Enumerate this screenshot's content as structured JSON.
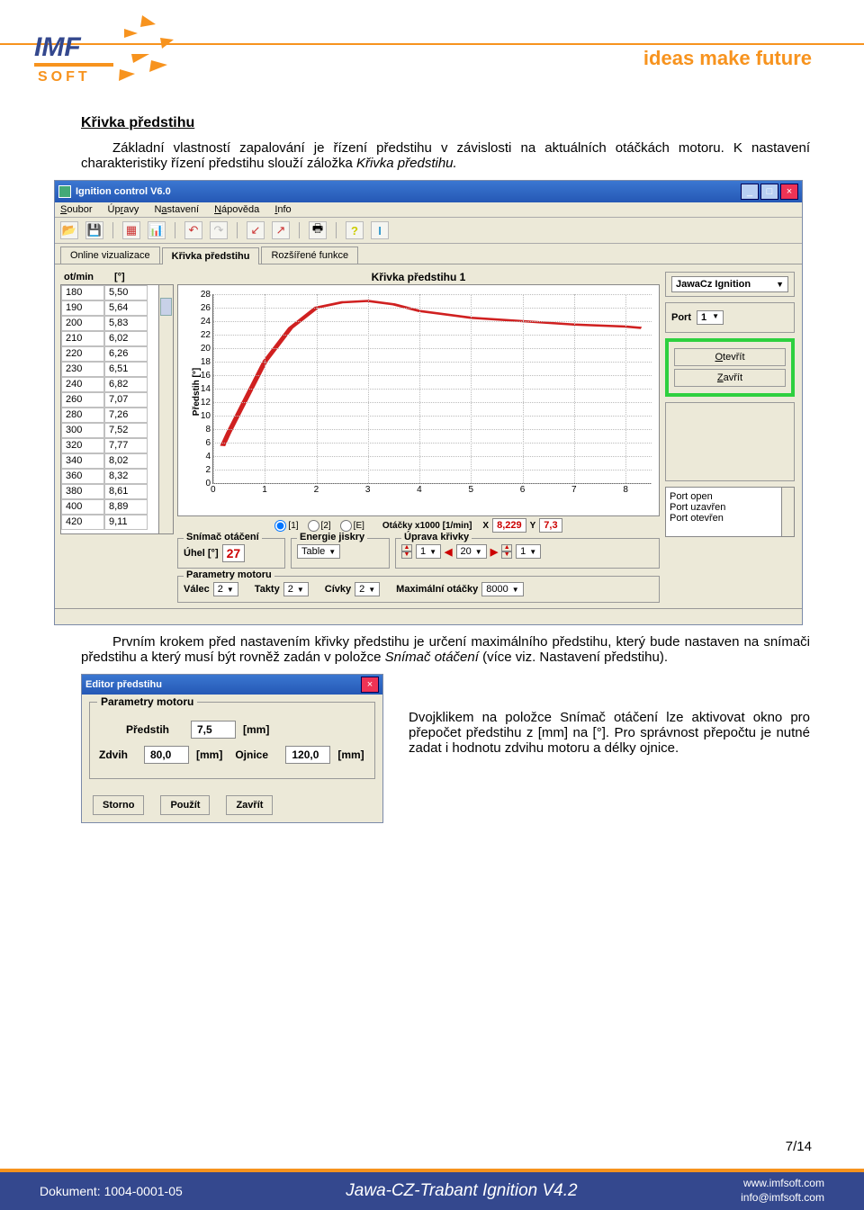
{
  "tagline": "ideas make future",
  "heading": "Křivka předstihu",
  "para1a": "Základní vlastností zapalování je řízení předstihu v závislosti na aktuálních otáčkách motoru. K nastavení charakteristiky řízení předstihu slouží záložka ",
  "para1b": "Křivka předstihu.",
  "para2a": "Prvním krokem před nastavením křivky předstihu je určení maximálního předstihu, který bude nastaven na snímači předstihu a který musí být rovněž zadán v položce ",
  "para2b": "Snímač otáčení",
  "para2c": " (více viz. Nastavení předstihu).",
  "para3": "Dvojklikem na položce Snímač otáčení lze aktivovat okno pro přepočet předstihu z [mm] na [°]. Pro správnost přepočtu je nutné zadat i hodnotu zdvihu motoru a délky ojnice.",
  "app": {
    "title": "Ignition control V6.0",
    "menu": [
      "Soubor",
      "Úpravy",
      "Nastavení",
      "Nápověda",
      "Info"
    ],
    "tabs": [
      "Online vizualizace",
      "Křivka předstihu",
      "Rozšířené funkce"
    ],
    "col1": "ot/min",
    "col2": "[°]",
    "tableRows": [
      [
        "180",
        "5,50"
      ],
      [
        "190",
        "5,64"
      ],
      [
        "200",
        "5,83"
      ],
      [
        "210",
        "6,02"
      ],
      [
        "220",
        "6,26"
      ],
      [
        "230",
        "6,51"
      ],
      [
        "240",
        "6,82"
      ],
      [
        "260",
        "7,07"
      ],
      [
        "280",
        "7,26"
      ],
      [
        "300",
        "7,52"
      ],
      [
        "320",
        "7,77"
      ],
      [
        "340",
        "8,02"
      ],
      [
        "360",
        "8,32"
      ],
      [
        "380",
        "8,61"
      ],
      [
        "400",
        "8,89"
      ],
      [
        "420",
        "9,11"
      ]
    ],
    "chartTitle": "Křivka předstihu 1",
    "yAxisLabel": "Předstih [°]",
    "yticks": [
      "28",
      "26",
      "24",
      "22",
      "20",
      "18",
      "16",
      "14",
      "12",
      "10",
      "8",
      "6",
      "4",
      "2",
      "0"
    ],
    "xticks": [
      "0",
      "1",
      "2",
      "3",
      "4",
      "5",
      "6",
      "7",
      "8"
    ],
    "radios": [
      "[1]",
      "[2]",
      "[E]"
    ],
    "xAxisTitle": "Otáčky x1000 [1/min]",
    "xLabel": "X",
    "xVal": "8,229",
    "yLabel": "Y",
    "yVal": "7,3",
    "config": "JawaCz Ignition",
    "portLabel": "Port",
    "portVal": "1",
    "openBtn": "Otevřít",
    "closeBtn": "Zavřít",
    "log": [
      "Port open",
      "Port uzavřen",
      "Port otevřen"
    ],
    "g_snimac": "Snímač otáčení",
    "uhel": "Úhel [°]",
    "uhelVal": "27",
    "g_energie": "Energie jiskry",
    "energVal": "Table",
    "g_uprava": "Úprava křivky",
    "upr1": "1",
    "upr2": "20",
    "upr3": "1",
    "g_param": "Parametry motoru",
    "valec": "Válec",
    "valecVal": "2",
    "takty": "Takty",
    "taktyVal": "2",
    "civky": "Cívky",
    "civkyVal": "2",
    "maxot": "Maximální otáčky",
    "maxotVal": "8000"
  },
  "editor": {
    "title": "Editor předstihu",
    "group": "Parametry motoru",
    "predstih": "Předstih",
    "predstihVal": "7,5",
    "predstihUnit": "[mm]",
    "zdvih": "Zdvih",
    "zdvihVal": "80,0",
    "zdvihUnit": "[mm]",
    "ojnice": "Ojnice",
    "ojniceVal": "120,0",
    "ojniceUnit": "[mm]",
    "storno": "Storno",
    "pouzit": "Použít",
    "zavrit": "Zavřít"
  },
  "chart_data": {
    "type": "line",
    "title": "Křivka předstihu 1",
    "xlabel": "Otáčky x1000 [1/min]",
    "ylabel": "Předstih [°]",
    "xlim": [
      0,
      8.5
    ],
    "ylim": [
      0,
      28
    ],
    "x": [
      0.18,
      0.3,
      0.6,
      1.0,
      1.5,
      2.0,
      2.5,
      3.0,
      3.5,
      4.0,
      5.0,
      6.0,
      7.0,
      8.0,
      8.3
    ],
    "values": [
      5.5,
      7.5,
      12.0,
      18.0,
      23.0,
      26.0,
      26.8,
      27.0,
      26.5,
      25.5,
      24.5,
      24.0,
      23.5,
      23.2,
      23.0
    ]
  },
  "pageNum": "7/14",
  "footer": {
    "doc": "Dokument: 1004-0001-05",
    "mid": "Jawa-CZ-Trabant Ignition V4.2",
    "r1": "www.imfsoft.com",
    "r2": "info@imfsoft.com"
  }
}
